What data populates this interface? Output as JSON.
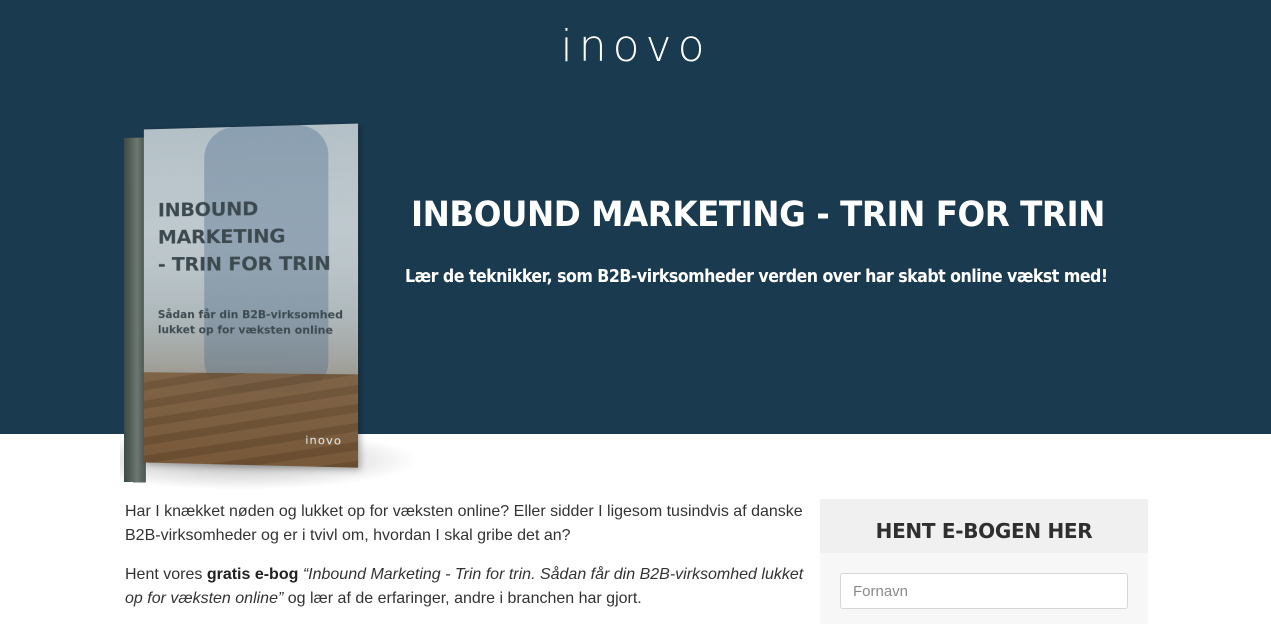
{
  "header": {
    "logo_text": "INOVO"
  },
  "hero": {
    "title": "INBOUND MARKETING - TRIN FOR TRIN",
    "subtitle": "Lær de teknikker, som B2B-virksomheder verden over har skabt online vækst med!",
    "background_color": "#1a3a4f"
  },
  "book": {
    "title_line1": "INBOUND",
    "title_line2": "MARKETING",
    "title_line3": "- TRIN FOR TRIN",
    "desc_line1": "Sådan får din B2B-virksomhed",
    "desc_line2": "lukket op for væksten online",
    "logo": "inovo"
  },
  "content": {
    "intro": "Har I knækket nøden og lukket op for væksten online? Eller sidder I ligesom tusindvis af danske B2B-virksomheder og er i tvivl om, hvordan I skal gribe det an?",
    "offer_prefix": "Hent vores ",
    "offer_bold": "gratis e-bog",
    "offer_italic": "“Inbound Marketing - Trin for trin. Sådan får din B2B-virksomhed lukket op for væksten online”",
    "offer_suffix": " og lær af de erfaringer, andre i branchen har gjort."
  },
  "form": {
    "heading": "HENT E-BOGEN HER",
    "first_name_placeholder": "Fornavn",
    "first_name_value": ""
  }
}
